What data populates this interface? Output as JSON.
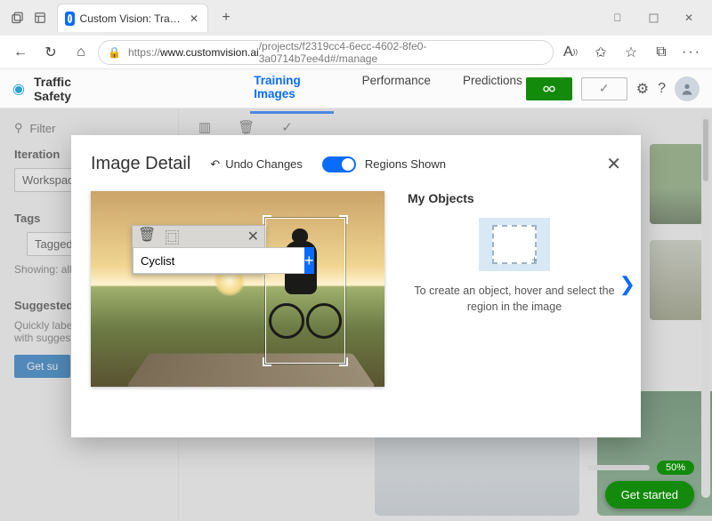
{
  "browser": {
    "tab_title": "Custom Vision: Traffic Safety - Tr",
    "url_proto": "https://",
    "url_host": "www.customvision.ai",
    "url_path": "/projects/f2319cc4-6ecc-4602-8fe0-3a0714b7ee4d#/manage"
  },
  "cv": {
    "project_name": "Traffic Safety",
    "tabs": {
      "training": "Training Images",
      "performance": "Performance",
      "predictions": "Predictions"
    }
  },
  "sidebar": {
    "filter": "Filter",
    "iteration": "Iteration",
    "iteration_value": "Workspace",
    "tags": "Tags",
    "tags_value": "Tagged",
    "showing": "Showing: all",
    "suggested": "Suggested",
    "suggested_hint1": "Quickly label y",
    "suggested_hint2": "with suggested",
    "get_suggestions": "Get su"
  },
  "modal": {
    "title": "Image Detail",
    "undo": "Undo Changes",
    "regions_shown": "Regions Shown",
    "tag_value": "Cyclist",
    "my_objects": "My Objects",
    "hint": "To create an object, hover and select the region in the image"
  },
  "footer": {
    "progress": "50%",
    "get_started": "Get started"
  }
}
